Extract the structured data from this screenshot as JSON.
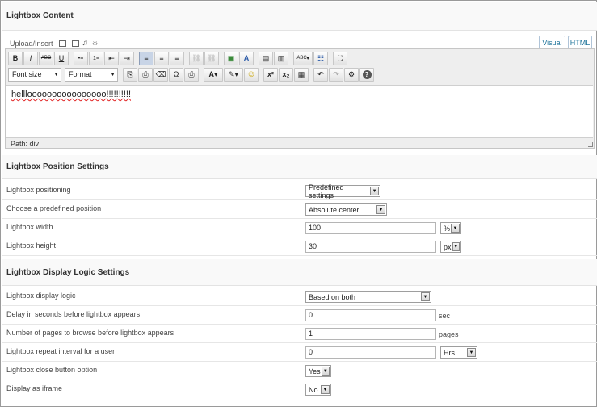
{
  "content_section": {
    "title": "Lightbox Content",
    "upload_label": "Upload/Insert",
    "tab_visual": "Visual",
    "tab_html": "HTML",
    "toolbar1": [
      "B",
      "I",
      "ABC",
      "U",
      "•≡",
      "1≡",
      "⇤",
      "⇥",
      "≡",
      "≡",
      "≡",
      "⛓",
      "⛓",
      "▣",
      "A",
      "▤",
      "▥",
      "ABC",
      "☷",
      "⛶"
    ],
    "font_size_label": "Font size",
    "format_label": "Format",
    "toolbar2": [
      "⎘",
      "⎙",
      "⌫",
      "Ω",
      "⎙",
      "A",
      "✎",
      "☺",
      "x²",
      "x₂",
      "▦",
      "↶",
      "↷",
      "⚙",
      "?"
    ],
    "editor_text": "hellloooooooooooooooo!!!!!!!!!!",
    "path_text": "Path: div"
  },
  "position_section": {
    "title": "Lightbox Position Settings",
    "rows": [
      {
        "label": "Lightbox positioning",
        "value": "Predefined settings"
      },
      {
        "label": "Choose a predefined position",
        "value": "Absolute center"
      },
      {
        "label": "Lightbox width",
        "value": "100",
        "unit": "%"
      },
      {
        "label": "Lightbox height",
        "value": "30",
        "unit": "px"
      }
    ]
  },
  "logic_section": {
    "title": "Lightbox Display Logic Settings",
    "rows": [
      {
        "label": "Lightbox display logic",
        "value": "Based on both"
      },
      {
        "label": "Delay in seconds before lightbox appears",
        "value": "0",
        "unit": "sec"
      },
      {
        "label": "Number of pages to browse before lightbox appears",
        "value": "1",
        "unit": "pages"
      },
      {
        "label": "Lightbox repeat interval for a user",
        "value": "0",
        "unit": "Hrs"
      },
      {
        "label": "Lightbox close button option",
        "value": "Yes"
      },
      {
        "label": "Display as iframe",
        "value": "No"
      }
    ]
  },
  "colors": {
    "accent": "#21759b",
    "spell_error": "#e02020",
    "active_tool": "#c8d4e6"
  }
}
